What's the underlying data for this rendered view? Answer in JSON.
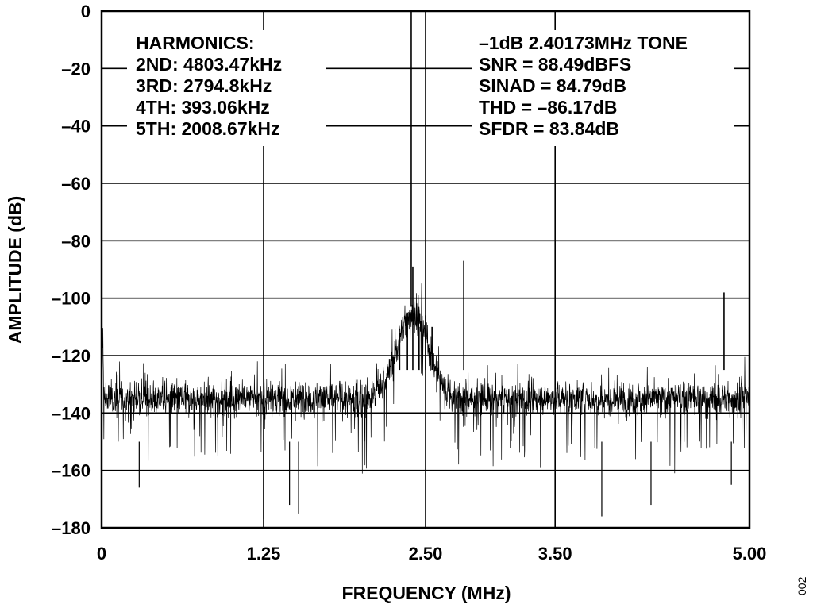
{
  "chart_data": {
    "type": "line",
    "xlabel": "FREQUENCY (MHz)",
    "ylabel": "AMPLITUDE (dB)",
    "xlim": [
      0,
      5.0
    ],
    "ylim": [
      -180,
      0
    ],
    "x_ticks": [
      0,
      1.25,
      2.5,
      3.5,
      5.0
    ],
    "x_tick_labels": [
      "0",
      "1.25",
      "2.50",
      "3.50",
      "5.00"
    ],
    "y_ticks": [
      0,
      -20,
      -40,
      -60,
      -80,
      -100,
      -120,
      -140,
      -160,
      -180
    ],
    "y_tick_labels": [
      "0",
      "–20",
      "–40",
      "–60",
      "–80",
      "–100",
      "–120",
      "–140",
      "–160",
      "–180"
    ],
    "grid": true,
    "noise_floor_db": -135,
    "tone_mhz": 2.40173,
    "series": [
      {
        "x": [
          0,
          0.02,
          0.393,
          0.5,
          1.0,
          1.5,
          1.8,
          2.0,
          2.1,
          2.2,
          2.3,
          2.36,
          2.40173,
          2.45,
          2.5,
          2.55,
          2.6,
          2.7,
          2.7948,
          3.0,
          3.5,
          4.0,
          4.5,
          4.8035,
          5.0
        ],
        "y": [
          -104,
          -135,
          -130,
          -135,
          -135,
          -135,
          -134,
          -131,
          -126,
          -120,
          -112,
          -105,
          -89,
          -110,
          -106,
          -110,
          -125,
          -132,
          -87,
          -135,
          -135,
          -135,
          -135,
          -98,
          -135
        ]
      }
    ],
    "annotations": {
      "harmonics_title": "HARMONICS:",
      "harmonic_2": "2ND: 4803.47kHz",
      "harmonic_3": "3RD: 2794.8kHz",
      "harmonic_4": "4TH: 393.06kHz",
      "harmonic_5": "5TH: 2008.67kHz",
      "tone": "–1dB 2.40173MHz TONE",
      "snr": "SNR = 88.49dBFS",
      "sinad": "SINAD = 84.79dB",
      "thd": "THD = –86.17dB",
      "sfdr": "SFDR = 83.84dB"
    },
    "figure_id": "002"
  }
}
